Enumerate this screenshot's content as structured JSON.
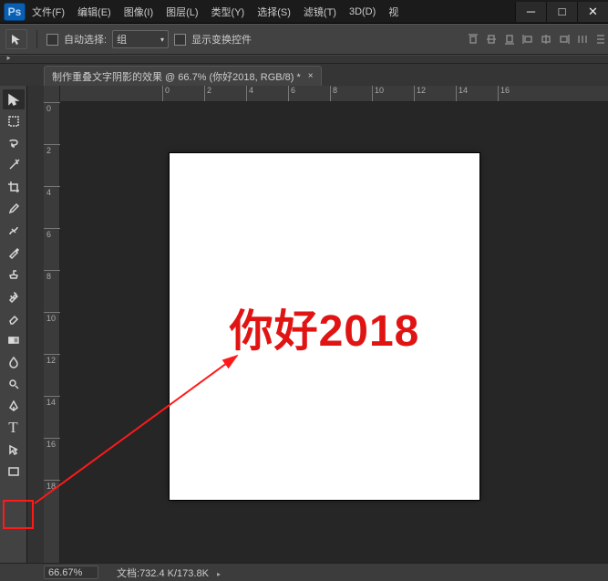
{
  "titlebar": {
    "logo_text": "Ps",
    "menus": [
      "文件(F)",
      "编辑(E)",
      "图像(I)",
      "图层(L)",
      "类型(Y)",
      "选择(S)",
      "滤镜(T)",
      "3D(D)",
      "视"
    ]
  },
  "optionbar": {
    "auto_select_label": "自动选择:",
    "group_label": "组",
    "show_transform_label": "显示变换控件"
  },
  "document_tab": {
    "title": "制作重叠文字阴影的效果 @ 66.7% (你好2018, RGB/8) *"
  },
  "ruler_h": [
    "0",
    "2",
    "4",
    "6",
    "8",
    "10",
    "12",
    "14",
    "16"
  ],
  "ruler_v": [
    "0",
    "2",
    "4",
    "6",
    "8",
    "10",
    "12",
    "14",
    "16",
    "18"
  ],
  "canvas": {
    "text": "你好2018",
    "text_color": "#e11414"
  },
  "statusbar": {
    "zoom": "66.67%",
    "docsize_label": "文档:",
    "docsize_value": "732.4 K/173.8K"
  }
}
